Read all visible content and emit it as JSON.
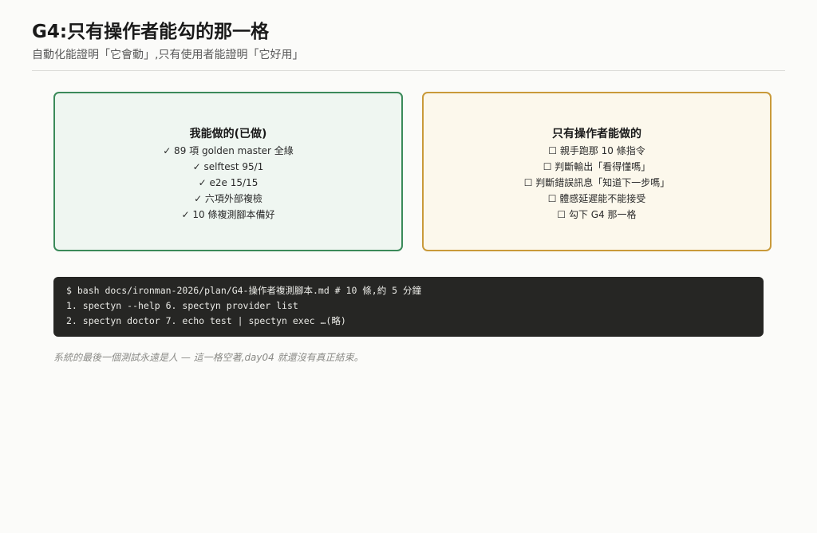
{
  "header": {
    "title": "G4:只有操作者能勾的那一格",
    "subtitle": "自動化能證明「它會動」,只有使用者能證明「它好用」"
  },
  "left_card": {
    "title": "我能做的(已做)",
    "items": [
      "✓ 89 項 golden master 全綠",
      "✓ selftest 95/1",
      "✓ e2e 15/15",
      "✓ 六項外部複檢",
      "✓ 10 條複測腳本備好"
    ]
  },
  "right_card": {
    "title": "只有操作者能做的",
    "items": [
      "☐ 親手跑那 10 條指令",
      "☐ 判斷輸出「看得懂嗎」",
      "☐ 判斷錯誤訊息「知道下一步嗎」",
      "☐ 體感延遲能不能接受",
      "☐ 勾下 G4 那一格"
    ]
  },
  "terminal": {
    "lines": [
      "$ bash docs/ironman-2026/plan/G4-操作者複測腳本.md # 10 條,約 5 分鐘",
      "1. spectyn --help 6. spectyn provider list",
      "2. spectyn doctor 7. echo test | spectyn exec …(略)"
    ]
  },
  "footnote": "系統的最後一個測試永遠是人 — 這一格空著,day04 就還沒有真正結束。",
  "colors": {
    "left_border": "#3b8a5a",
    "right_border": "#c99a3a",
    "terminal_bg": "#262624"
  }
}
